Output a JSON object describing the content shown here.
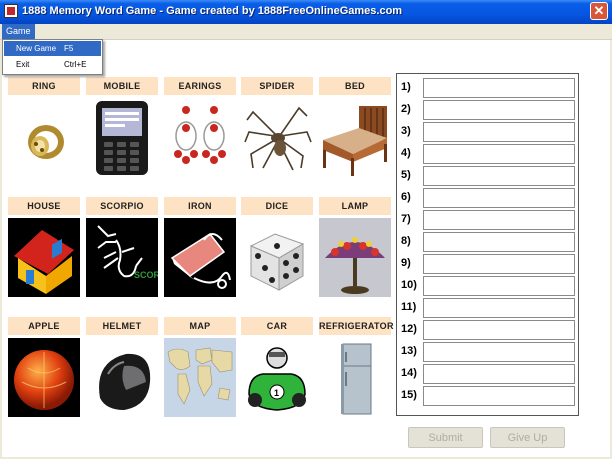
{
  "window": {
    "title": "1888 Memory Word Game - Game created by 1888FreeOnlineGames.com",
    "close_label": "✕"
  },
  "menubar": {
    "game": "Game"
  },
  "game_menu": {
    "new_game": "New Game",
    "new_game_shortcut": "F5",
    "exit": "Exit",
    "exit_shortcut": "Ctrl+E"
  },
  "cards": [
    {
      "label": "RING",
      "icon": "ring-icon"
    },
    {
      "label": "MOBILE",
      "icon": "mobile-phone-icon"
    },
    {
      "label": "EARINGS",
      "icon": "earrings-icon"
    },
    {
      "label": "SPIDER",
      "icon": "spider-icon"
    },
    {
      "label": "BED",
      "icon": "bed-icon"
    },
    {
      "label": "HOUSE",
      "icon": "house-icon"
    },
    {
      "label": "SCORPIO",
      "icon": "scorpion-icon",
      "caption": "SCORPIO"
    },
    {
      "label": "IRON",
      "icon": "iron-icon"
    },
    {
      "label": "DICE",
      "icon": "dice-icon"
    },
    {
      "label": "LAMP",
      "icon": "lamp-icon"
    },
    {
      "label": "APPLE",
      "icon": "apple-icon"
    },
    {
      "label": "HELMET",
      "icon": "helmet-icon"
    },
    {
      "label": "MAP",
      "icon": "world-map-icon"
    },
    {
      "label": "CAR",
      "icon": "race-car-icon",
      "caption": "1"
    },
    {
      "label": "REFRIGERATOR",
      "icon": "refrigerator-icon"
    }
  ],
  "answers": [
    "1)",
    "2)",
    "3)",
    "4)",
    "5)",
    "6)",
    "7)",
    "8)",
    "9)",
    "10)",
    "11)",
    "12)",
    "13)",
    "14)",
    "15)"
  ],
  "buttons": {
    "submit": "Submit",
    "give_up": "Give Up"
  }
}
